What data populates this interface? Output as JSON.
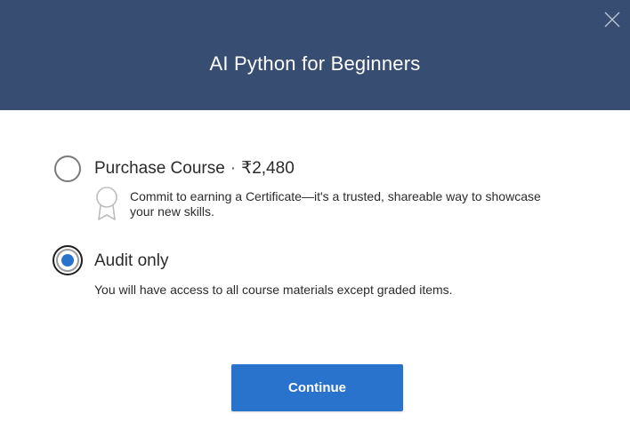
{
  "dialog": {
    "title": "AI Python for Beginners",
    "close_icon": "close-icon"
  },
  "options": {
    "purchase": {
      "label": "Purchase Course",
      "separator": "·",
      "price": "₹2,480",
      "selected": false,
      "icon": "certificate-icon",
      "description": "Commit to earning a Certificate—it's a trusted, shareable way to showcase your new skills."
    },
    "audit": {
      "label": "Audit only",
      "selected": true,
      "description": "You will have access to all course materials except graded items."
    }
  },
  "actions": {
    "continue_label": "Continue"
  },
  "colors": {
    "header_background": "#384d72",
    "accent": "#2a73cc",
    "text": "#2b2b2b"
  }
}
